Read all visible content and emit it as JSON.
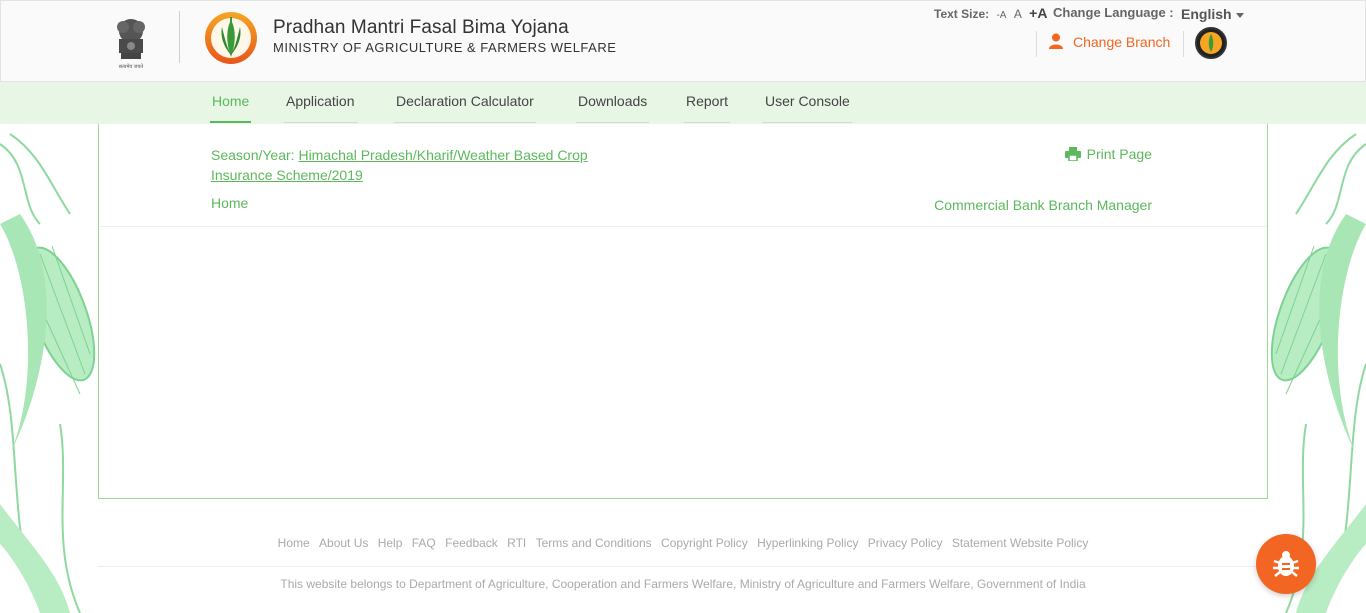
{
  "header": {
    "emblem_caption": "सत्यमेव जयते",
    "title": "Pradhan Mantri Fasal Bima Yojana",
    "subtitle": "MINISTRY OF AGRICULTURE & FARMERS WELFARE",
    "text_size_label": "Text Size:",
    "text_size_small": "-A",
    "text_size_normal": "A",
    "text_size_large": "+A",
    "change_language_label": "Change Language :",
    "language": "English",
    "change_branch": "Change Branch"
  },
  "nav": {
    "items": [
      {
        "label": "Home",
        "active": true
      },
      {
        "label": "Application",
        "active": false
      },
      {
        "label": "Declaration Calculator",
        "active": false
      },
      {
        "label": "Downloads",
        "active": false
      },
      {
        "label": "Report",
        "active": false
      },
      {
        "label": "User Console",
        "active": false
      }
    ]
  },
  "content": {
    "season_label": "Season/Year:",
    "season_value": "Himachal Pradesh/Kharif/Weather Based Crop Insurance Scheme/2019",
    "breadcrumb_home": "Home",
    "print_page": "Print Page",
    "role": "Commercial Bank Branch Manager"
  },
  "footer": {
    "links": [
      "Home",
      "About Us",
      "Help",
      "FAQ",
      "Feedback",
      "RTI",
      "Terms and Conditions",
      "Copyright Policy",
      "Hyperlinking Policy",
      "Privacy Policy",
      "Statement Website Policy"
    ],
    "note": "This website belongs to Department of Agriculture, Cooperation and Farmers Welfare, Ministry of Agriculture and Farmers Welfare, Government of India"
  },
  "colors": {
    "accent_green": "#5cb85c",
    "accent_orange": "#f26522",
    "nav_bg": "#e8f6e6"
  },
  "icons": {
    "emblem": "national-emblem-icon",
    "logo": "pmfby-logo-icon",
    "user": "user-icon",
    "print": "printer-icon",
    "bug": "bug-icon"
  }
}
